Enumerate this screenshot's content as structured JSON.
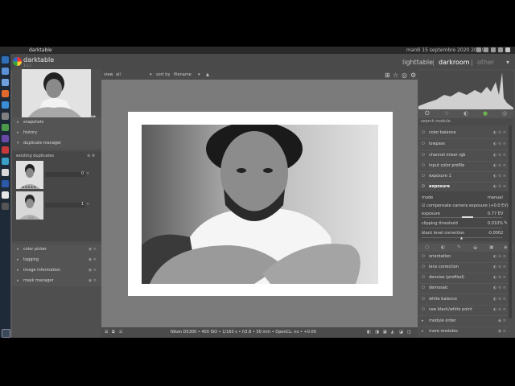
{
  "system": {
    "window_title": "darktable",
    "datetime": "mardi 15 septembre 2020 20:49"
  },
  "app": {
    "name": "darktable",
    "version": "3.2.1",
    "views": [
      "lighttable",
      "darkroom",
      "other"
    ],
    "view_sep": "|",
    "other_caret": "▾"
  },
  "left_panel": {
    "modules_top": [
      {
        "label": "snapshots"
      },
      {
        "label": "history"
      },
      {
        "label": "duplicate manager"
      }
    ],
    "existing_duplicates_label": "existing duplicates",
    "duplicates": [
      {
        "num": "0",
        "stars": "★★★★★"
      },
      {
        "num": "1",
        "stars": "☆☆"
      }
    ],
    "modules_bottom": [
      {
        "label": "color picker"
      },
      {
        "label": "tagging"
      },
      {
        "label": "image information"
      },
      {
        "label": "mask manager"
      }
    ]
  },
  "toolbar": {
    "view_label": "view",
    "view_value": "all",
    "sort_label": "sort by",
    "sort_value": "filename"
  },
  "statusbar": {
    "info": "Nikon D5300 • 400 ISO • 1/160 s • f/2.8 • 50 mm • OpenCL: no • +0.00"
  },
  "right_panel": {
    "search_placeholder": "search module",
    "modules_top": [
      {
        "label": "color balance"
      },
      {
        "label": "lowpass"
      },
      {
        "label": "channel mixer rgb"
      },
      {
        "label": "input color profile"
      },
      {
        "label": "exposure 1"
      },
      {
        "label": "exposure"
      }
    ],
    "exposure": {
      "mode_label": "mode",
      "mode_value": "manual",
      "compensate_label": "compensate camera exposure (+0.0 EV)",
      "exposure_label": "exposure",
      "exposure_value": "0.77 EV",
      "clipping_label": "clipping threshold",
      "clipping_value": "0.010%",
      "black_label": "black level correction",
      "black_value": "-0.0002"
    },
    "modules_bottom": [
      {
        "label": "orientation"
      },
      {
        "label": "lens correction"
      },
      {
        "label": "denoise (profiled)"
      },
      {
        "label": "demosaic"
      },
      {
        "label": "white balance"
      },
      {
        "label": "raw black/white point"
      },
      {
        "label": "module order"
      },
      {
        "label": "more modules"
      }
    ]
  },
  "colors": {
    "accent": "#4e7fbf",
    "panel_bg": "#4f4f4f",
    "center_bg": "#7b7b7b"
  }
}
